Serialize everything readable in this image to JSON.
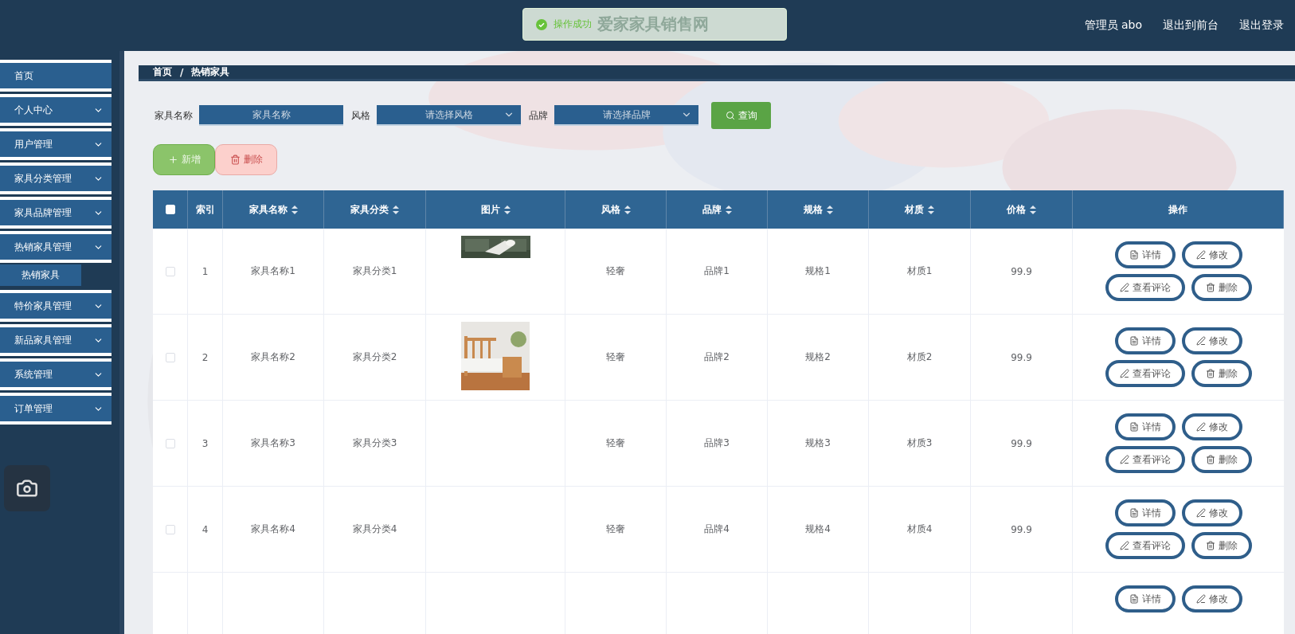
{
  "header": {
    "title": "爱家家具销售网",
    "toast": {
      "kind": "success",
      "text": "操作成功"
    },
    "links": [
      {
        "label": "管理员 abo"
      },
      {
        "label": "退出到前台"
      },
      {
        "label": "退出登录"
      }
    ]
  },
  "sidebar": {
    "items": [
      {
        "label": "首页",
        "kind": "link"
      },
      {
        "label": "个人中心",
        "kind": "group"
      },
      {
        "label": "用户管理",
        "kind": "group"
      },
      {
        "label": "家具分类管理",
        "kind": "group"
      },
      {
        "label": "家具品牌管理",
        "kind": "group"
      },
      {
        "label": "热销家具管理",
        "kind": "group",
        "expanded": true,
        "children": [
          {
            "label": "热销家具",
            "selected": true
          }
        ]
      },
      {
        "label": "特价家具管理",
        "kind": "group"
      },
      {
        "label": "新品家具管理",
        "kind": "group"
      },
      {
        "label": "系统管理",
        "kind": "group"
      },
      {
        "label": "订单管理",
        "kind": "group"
      }
    ]
  },
  "breadcrumb": {
    "items": [
      "首页",
      "热销家具"
    ],
    "separator": "/"
  },
  "search": {
    "fields": [
      {
        "label": "家具名称",
        "kind": "input",
        "placeholder": "家具名称"
      },
      {
        "label": "风格",
        "kind": "select",
        "placeholder": "请选择风格"
      },
      {
        "label": "品牌",
        "kind": "select",
        "placeholder": "请选择品牌"
      }
    ],
    "button": "查询"
  },
  "toolbar": [
    {
      "label": "新增",
      "kind": "add",
      "disabled": false
    },
    {
      "label": "删除",
      "kind": "delete",
      "disabled": true
    }
  ],
  "table": {
    "columns": [
      {
        "kind": "checkbox",
        "checked": false
      },
      {
        "kind": "text",
        "label": "索引",
        "sortable": false
      },
      {
        "kind": "text",
        "label": "家具名称",
        "sortable": true
      },
      {
        "kind": "text",
        "label": "家具分类",
        "sortable": true
      },
      {
        "kind": "text",
        "label": "图片",
        "sortable": true
      },
      {
        "kind": "text",
        "label": "风格",
        "sortable": true
      },
      {
        "kind": "text",
        "label": "品牌",
        "sortable": true
      },
      {
        "kind": "text",
        "label": "规格",
        "sortable": true
      },
      {
        "kind": "text",
        "label": "材质",
        "sortable": true
      },
      {
        "kind": "text",
        "label": "价格",
        "sortable": true
      },
      {
        "kind": "text",
        "label": "操作",
        "sortable": false
      }
    ],
    "rows": [
      {
        "selected": false,
        "index": "1",
        "name": "家具名称1",
        "category": "家具分类1",
        "image": {
          "kind": "picture"
        },
        "style": "轻奢",
        "brand": "品牌1",
        "spec": "规格1",
        "material": "材质1",
        "price": "99.9",
        "actions": [
          {
            "label": "详情",
            "kind": "detail"
          },
          {
            "label": "修改",
            "kind": "edit"
          },
          {
            "label": "查看评论",
            "kind": "comments"
          },
          {
            "label": "删除",
            "kind": "delete"
          }
        ]
      },
      {
        "selected": false,
        "index": "2",
        "name": "家具名称2",
        "category": "家具分类2",
        "image": {
          "kind": "picture"
        },
        "style": "轻奢",
        "brand": "品牌2",
        "spec": "规格2",
        "material": "材质2",
        "price": "99.9",
        "actions": [
          {
            "label": "详情",
            "kind": "detail"
          },
          {
            "label": "修改",
            "kind": "edit"
          },
          {
            "label": "查看评论",
            "kind": "comments"
          },
          {
            "label": "删除",
            "kind": "delete"
          }
        ]
      },
      {
        "selected": false,
        "index": "3",
        "name": "家具名称3",
        "category": "家具分类3",
        "style": "轻奢",
        "brand": "品牌3",
        "spec": "规格3",
        "material": "材质3",
        "price": "99.9",
        "actions": [
          {
            "label": "详情",
            "kind": "detail"
          },
          {
            "label": "修改",
            "kind": "edit"
          },
          {
            "label": "查看评论",
            "kind": "comments"
          },
          {
            "label": "删除",
            "kind": "delete"
          }
        ]
      },
      {
        "selected": false,
        "index": "4",
        "name": "家具名称4",
        "category": "家具分类4",
        "style": "轻奢",
        "brand": "品牌4",
        "spec": "规格4",
        "material": "材质4",
        "price": "99.9",
        "actions": [
          {
            "label": "详情",
            "kind": "detail"
          },
          {
            "label": "修改",
            "kind": "edit"
          },
          {
            "label": "查看评论",
            "kind": "comments"
          },
          {
            "label": "删除",
            "kind": "delete"
          }
        ]
      },
      {
        "actions": [
          {
            "label": "详情",
            "kind": "detail"
          },
          {
            "label": "修改",
            "kind": "edit"
          }
        ]
      }
    ]
  }
}
